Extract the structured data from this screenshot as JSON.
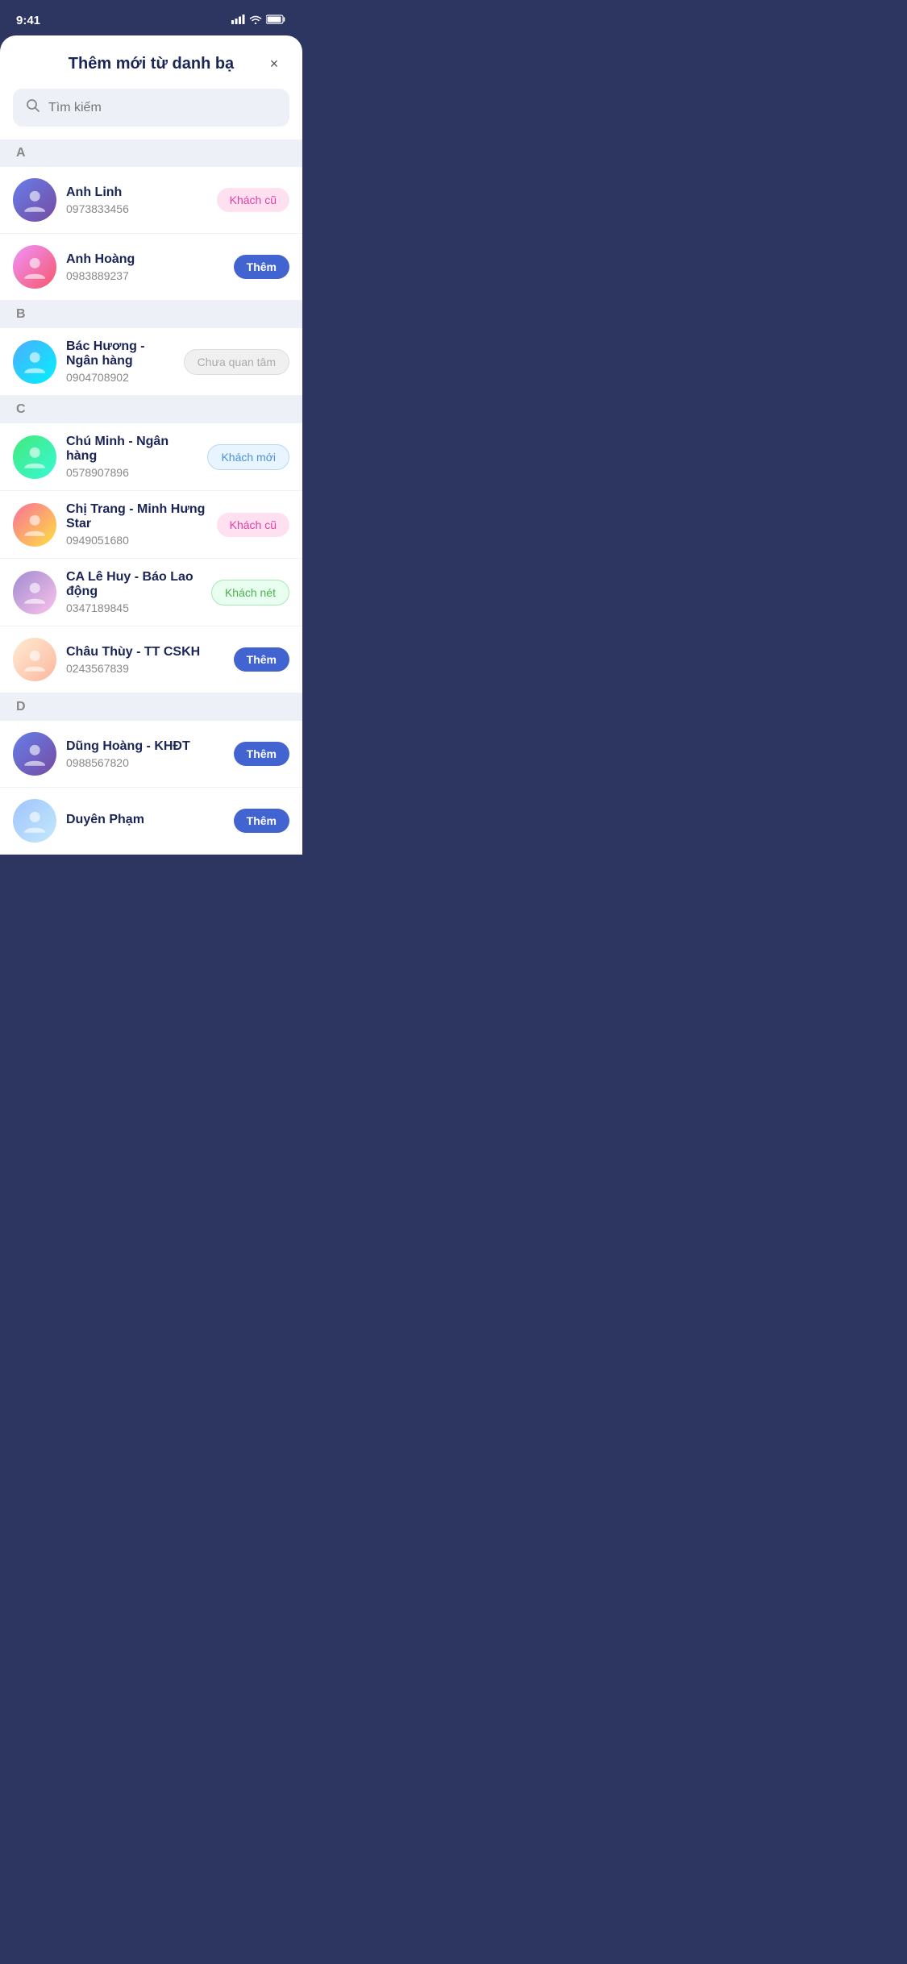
{
  "statusBar": {
    "time": "9:41"
  },
  "header": {
    "title": "Thêm mới từ danh bạ",
    "closeLabel": "×"
  },
  "search": {
    "placeholder": "Tìm kiếm"
  },
  "sections": [
    {
      "letter": "A",
      "contacts": [
        {
          "id": 1,
          "name": "Anh Linh",
          "phone": "0973833456",
          "badgeType": "khach-cu",
          "badgeLabel": "Khách cũ",
          "avatarClass": "avatar-1"
        },
        {
          "id": 2,
          "name": "Anh Hoàng",
          "phone": "0983889237",
          "badgeType": "them",
          "badgeLabel": "Thêm",
          "avatarClass": "avatar-2"
        }
      ]
    },
    {
      "letter": "B",
      "contacts": [
        {
          "id": 3,
          "name": "Bác Hương - Ngân hàng",
          "phone": "0904708902",
          "badgeType": "chua-quan-tam",
          "badgeLabel": "Chưa quan tâm",
          "avatarClass": "avatar-3"
        }
      ]
    },
    {
      "letter": "C",
      "contacts": [
        {
          "id": 4,
          "name": "Chú Minh - Ngân hàng",
          "phone": "0578907896",
          "badgeType": "khach-moi",
          "badgeLabel": "Khách mới",
          "avatarClass": "avatar-4"
        },
        {
          "id": 5,
          "name": "Chị Trang - Minh Hưng Star",
          "phone": "0949051680",
          "badgeType": "khach-cu",
          "badgeLabel": "Khách cũ",
          "avatarClass": "avatar-5"
        },
        {
          "id": 6,
          "name": "CA Lê Huy - Báo Lao động",
          "phone": "0347189845",
          "badgeType": "khach-net",
          "badgeLabel": "Khách nét",
          "avatarClass": "avatar-6"
        },
        {
          "id": 7,
          "name": "Châu Thùy - TT CSKH",
          "phone": "0243567839",
          "badgeType": "them",
          "badgeLabel": "Thêm",
          "avatarClass": "avatar-7"
        }
      ]
    },
    {
      "letter": "D",
      "contacts": [
        {
          "id": 8,
          "name": "Dũng Hoàng - KHĐT",
          "phone": "0988567820",
          "badgeType": "them",
          "badgeLabel": "Thêm",
          "avatarClass": "avatar-8"
        },
        {
          "id": 9,
          "name": "Duyên Phạm",
          "phone": "",
          "badgeType": "them",
          "badgeLabel": "Thêm",
          "avatarClass": "avatar-9"
        }
      ]
    }
  ]
}
